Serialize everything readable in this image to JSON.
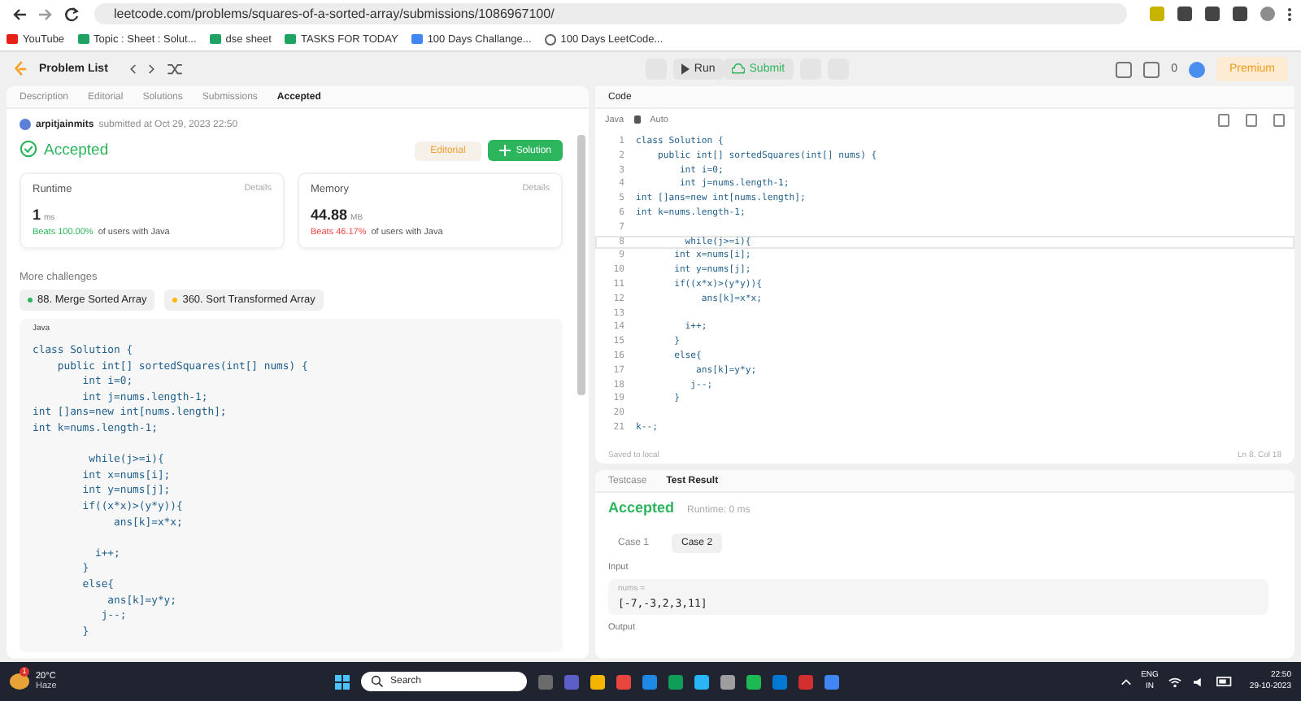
{
  "browser": {
    "url": "leetcode.com/problems/squares-of-a-sorted-array/submissions/1086967100/",
    "bookmarks": [
      {
        "label": "YouTube",
        "kind": "video"
      },
      {
        "label": "Topic : Sheet : Solut...",
        "kind": "sheet"
      },
      {
        "label": "dse sheet",
        "kind": "sheet"
      },
      {
        "label": "TASKS FOR TODAY",
        "kind": "sheet"
      },
      {
        "label": "100 Days Challange...",
        "kind": "doc"
      },
      {
        "label": "100 Days LeetCode...",
        "kind": "web"
      }
    ]
  },
  "nav": {
    "problem_list": "Problem List",
    "run": "Run",
    "submit": "Submit",
    "streak": "0",
    "premium": "Premium"
  },
  "left": {
    "tabs": [
      {
        "label": "Description",
        "selected": false
      },
      {
        "label": "Editorial",
        "selected": false
      },
      {
        "label": "Solutions",
        "selected": false
      },
      {
        "label": "Submissions",
        "selected": false
      },
      {
        "label": "Accepted",
        "selected": true
      }
    ],
    "user": "arpitjainmits",
    "submitted": "submitted at Oct 29, 2023 22:50",
    "status": "Accepted",
    "editorial_button": "Editorial",
    "solution_button": "Solution",
    "stats": [
      {
        "title": "Runtime",
        "details": "Details",
        "value": "1",
        "unit": "ms",
        "beats": "Beats 100.00%",
        "suffix": "of users with Java",
        "color": "#2db55d"
      },
      {
        "title": "Memory",
        "details": "Details",
        "value": "44.88",
        "unit": "MB",
        "beats": "Beats 46.17%",
        "suffix": "of users with Java",
        "color": "#ef4743"
      }
    ],
    "more_title": "More challenges",
    "challenges": [
      {
        "label": "88. Merge Sorted Array",
        "color": "#2db55d"
      },
      {
        "label": "360. Sort Transformed Array",
        "color": "#ffb800"
      }
    ],
    "code_language": "Java",
    "code_blocks": [
      [
        "class Solution {",
        "    public int[] sortedSquares(int[] nums) {",
        "        int i=0;",
        "        int j=nums.length-1;",
        "int []ans=new int[nums.length];",
        "int k=nums.length-1;"
      ],
      [
        "         while(j>=i){",
        "        int x=nums[i];",
        "        int y=nums[j];",
        "        if((x*x)>(y*y)){",
        "             ans[k]=x*x;"
      ],
      [
        "          i++;",
        "        }",
        "        else{",
        "            ans[k]=y*y;",
        "           j--;",
        "        }"
      ]
    ]
  },
  "editor": {
    "title": "Code",
    "language": "Java",
    "mode": "Auto",
    "lines": [
      {
        "num": "1",
        "text": "class Solution {",
        "current": false
      },
      {
        "num": "2",
        "text": "    public int[] sortedSquares(int[] nums) {",
        "current": false
      },
      {
        "num": "3",
        "text": "        int i=0;",
        "current": false
      },
      {
        "num": "4",
        "text": "        int j=nums.length-1;",
        "current": false
      },
      {
        "num": "5",
        "text": "int []ans=new int[nums.length];",
        "current": false
      },
      {
        "num": "6",
        "text": "int k=nums.length-1;",
        "current": false
      },
      {
        "num": "7",
        "current": false
      },
      {
        "num": "8",
        "text": "         while(j>=i){",
        "current": true
      },
      {
        "num": "9",
        "text": "       int x=nums[i];",
        "current": false
      },
      {
        "num": "10",
        "text": "       int y=nums[j];",
        "current": false
      },
      {
        "num": "11",
        "text": "       if((x*x)>(y*y)){",
        "current": false
      },
      {
        "num": "12",
        "text": "            ans[k]=x*x;",
        "current": false
      },
      {
        "num": "13",
        "current": false
      },
      {
        "num": "14",
        "text": "         i++;",
        "current": false
      },
      {
        "num": "15",
        "text": "       }",
        "current": false
      },
      {
        "num": "16",
        "text": "       else{",
        "current": false
      },
      {
        "num": "17",
        "text": "           ans[k]=y*y;",
        "current": false
      },
      {
        "num": "18",
        "text": "          j--;",
        "current": false
      },
      {
        "num": "19",
        "text": "       }",
        "current": false
      },
      {
        "num": "20",
        "current": false
      },
      {
        "num": "21",
        "text": "k--;",
        "current": false
      }
    ],
    "saved": "Saved to local",
    "cursor": "Ln 8, Col 18"
  },
  "result": {
    "tabs": [
      {
        "label": "Testcase",
        "selected": false
      },
      {
        "label": "Test Result",
        "selected": true
      }
    ],
    "status": "Accepted",
    "runtime": "Runtime: 0 ms",
    "cases": [
      {
        "label": "Case 1",
        "selected": false
      },
      {
        "label": "Case 2",
        "selected": true
      }
    ],
    "input_label": "Input",
    "param": "nums =",
    "value": "[-7,-3,2,3,11]",
    "output_label": "Output"
  },
  "taskbar": {
    "temperature": "20°C",
    "weather": "Haze",
    "weather_badge": "1",
    "search": "Search",
    "lang": "ENG",
    "region": "IN",
    "time": "22:50",
    "date": "29-10-2023"
  }
}
